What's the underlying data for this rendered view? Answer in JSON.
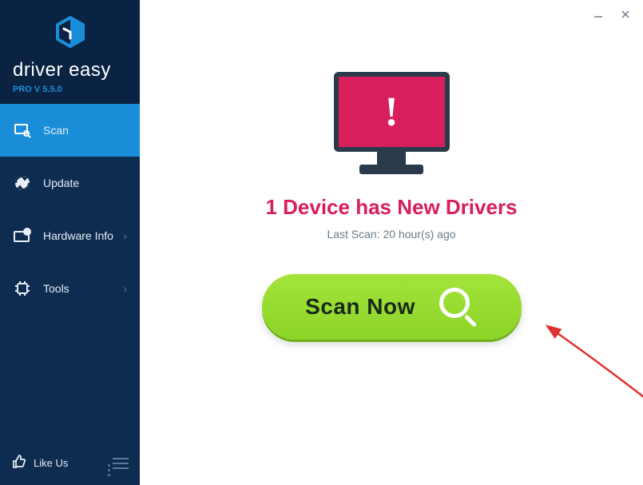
{
  "brand": {
    "name": "driver easy",
    "version": "PRO V 5.5.0"
  },
  "sidebar": {
    "items": [
      {
        "label": "Scan",
        "icon": "scan-icon",
        "active": true
      },
      {
        "label": "Update",
        "icon": "update-icon"
      },
      {
        "label": "Hardware Info",
        "icon": "hardware-info-icon"
      },
      {
        "label": "Tools",
        "icon": "tools-icon"
      }
    ],
    "like_label": "Like Us"
  },
  "main": {
    "headline": "1 Device has New Drivers",
    "last_scan": "Last Scan: 20 hour(s) ago",
    "scan_button": "Scan Now"
  },
  "colors": {
    "accent": "#1a8dd8",
    "alert": "#d81e5b",
    "action": "#8dd428",
    "sidebar_bg": "#0d2c4f"
  }
}
